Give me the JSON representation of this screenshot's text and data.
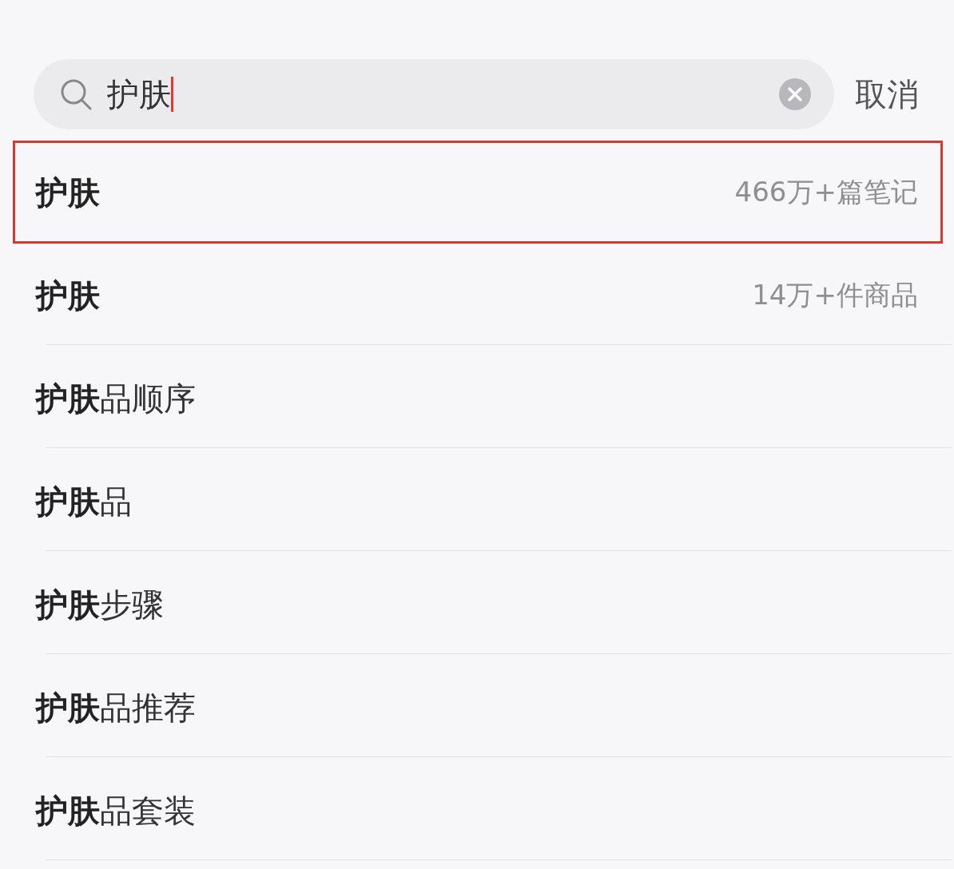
{
  "search": {
    "value": "护肤",
    "cancel": "取消"
  },
  "suggestions": [
    {
      "match": "护肤",
      "highlighted": true,
      "count": "466万+篇笔记"
    },
    {
      "match": "护肤",
      "highlighted": false,
      "count": "14万+件商品"
    },
    {
      "match": "护肤",
      "suffix": "品顺序",
      "highlighted": false
    },
    {
      "match": "护肤",
      "suffix": "品",
      "highlighted": false
    },
    {
      "match": "护肤",
      "suffix": "步骤",
      "highlighted": false
    },
    {
      "match": "护肤",
      "suffix": "品推荐",
      "highlighted": false
    },
    {
      "match": "护肤",
      "suffix": "品套装",
      "highlighted": false
    }
  ]
}
